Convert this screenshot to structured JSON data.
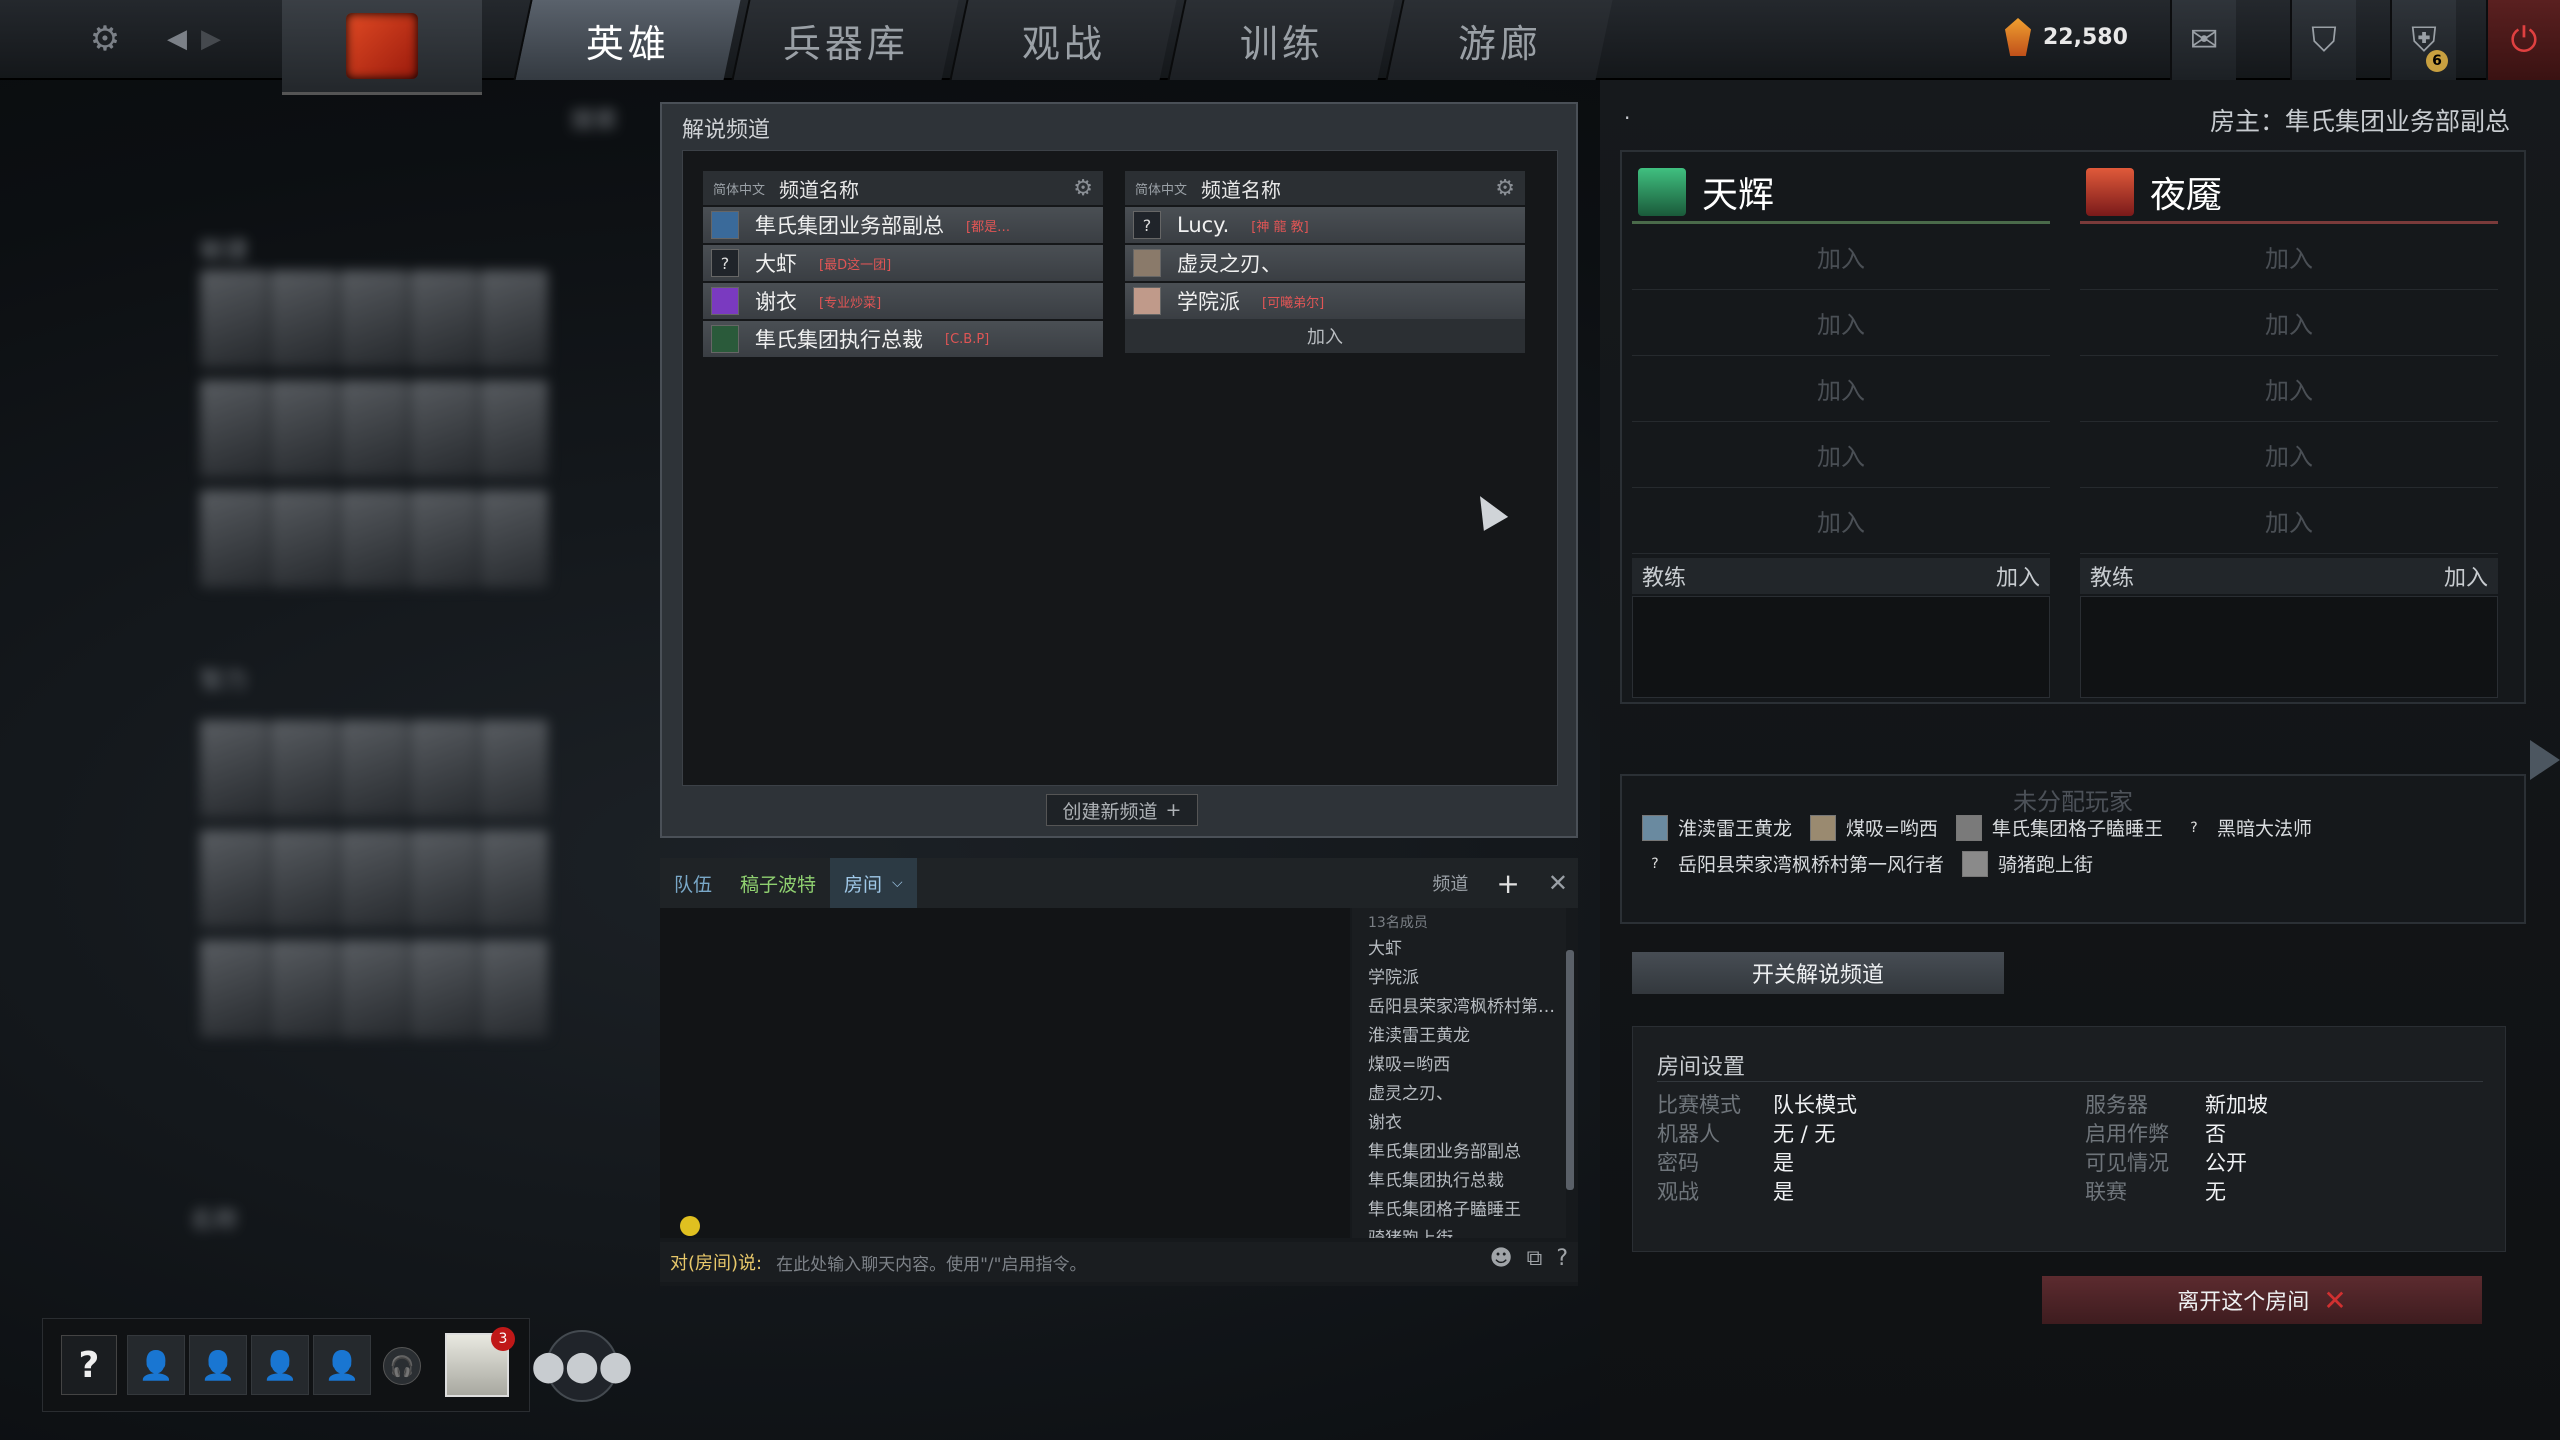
{
  "topbar": {
    "tabs": [
      "英雄",
      "兵器库",
      "观战",
      "训练",
      "游廊"
    ],
    "active_tab": "英雄",
    "currency": "22,580",
    "notification_count": "6"
  },
  "hero_grid": {
    "label_top": "敏捷",
    "label_mid": "智力",
    "label_filter": "名称",
    "label_search": "搜索"
  },
  "broadcast": {
    "title": "解说频道",
    "left_channel": {
      "lang": "简体中文",
      "name": "频道名称",
      "rows": [
        {
          "name": "隼氏集团业务部副总",
          "tag": "[都是…"
        },
        {
          "name": "大虾",
          "tag": "[最D这一团]"
        },
        {
          "name": "谢衣",
          "tag": "[专业炒菜]"
        },
        {
          "name": "隼氏集团执行总裁",
          "tag": "[C.B.P]"
        }
      ]
    },
    "right_channel": {
      "lang": "简体中文",
      "name": "频道名称",
      "rows": [
        {
          "name": "Lucy.",
          "tag": "[神 龍 教]"
        },
        {
          "name": "虚灵之刃、",
          "tag": ""
        },
        {
          "name": "学院派",
          "tag": "[可曦弟尔]"
        }
      ],
      "join": "加入"
    },
    "create_button": "创建新频道"
  },
  "chat": {
    "tabs": [
      "队伍",
      "稿子波特",
      "房间"
    ],
    "channel_label": "频道",
    "member_count": "13名成员",
    "members": [
      "大虾",
      "学院派",
      "岳阳县荣家湾枫桥村第…",
      "淮渎雷王黄龙",
      "煤吸=哟西",
      "虚灵之刃、",
      "谢衣",
      "隼氏集团业务部副总",
      "隼氏集团执行总裁",
      "隼氏集团格子瞌睡王",
      "骑猪跑上街"
    ],
    "input_prefix": "对(房间)说:",
    "input_placeholder": "在此处输入聊天内容。使用\"/\"启用指令。"
  },
  "lobby": {
    "dot": ".",
    "host": "房主：隼氏集团业务部副总",
    "radiant": "天辉",
    "dire": "夜魇",
    "join": "加入",
    "coach": "教练",
    "unassigned_title": "未分配玩家",
    "unassigned": [
      "淮渎雷王黄龙",
      "煤吸=哟西",
      "隼氏集团格子瞌睡王",
      "黑暗大法师",
      "岳阳县荣家湾枫桥村第一风行者",
      "骑猪跑上街"
    ],
    "toggle_broadcast": "开关解说频道",
    "settings_title": "房间设置",
    "settings_left": [
      {
        "key": "比赛模式",
        "value": "队长模式"
      },
      {
        "key": "机器人",
        "value": "无 / 无"
      },
      {
        "key": "密码",
        "value": "是"
      },
      {
        "key": "观战",
        "value": "是"
      }
    ],
    "settings_right": [
      {
        "key": "服务器",
        "value": "新加坡"
      },
      {
        "key": "启用作弊",
        "value": "否"
      },
      {
        "key": "可见情况",
        "value": "公开"
      },
      {
        "key": "联赛",
        "value": "无"
      }
    ],
    "leave_button": "离开这个房间"
  },
  "party": {
    "help": "?",
    "profile_badge": "3"
  },
  "colors": {
    "accent_radiant": "#40c080",
    "accent_dire": "#e05a3a",
    "chat_tab_blue": "#79a8c8",
    "leave_red": "#d03030"
  }
}
